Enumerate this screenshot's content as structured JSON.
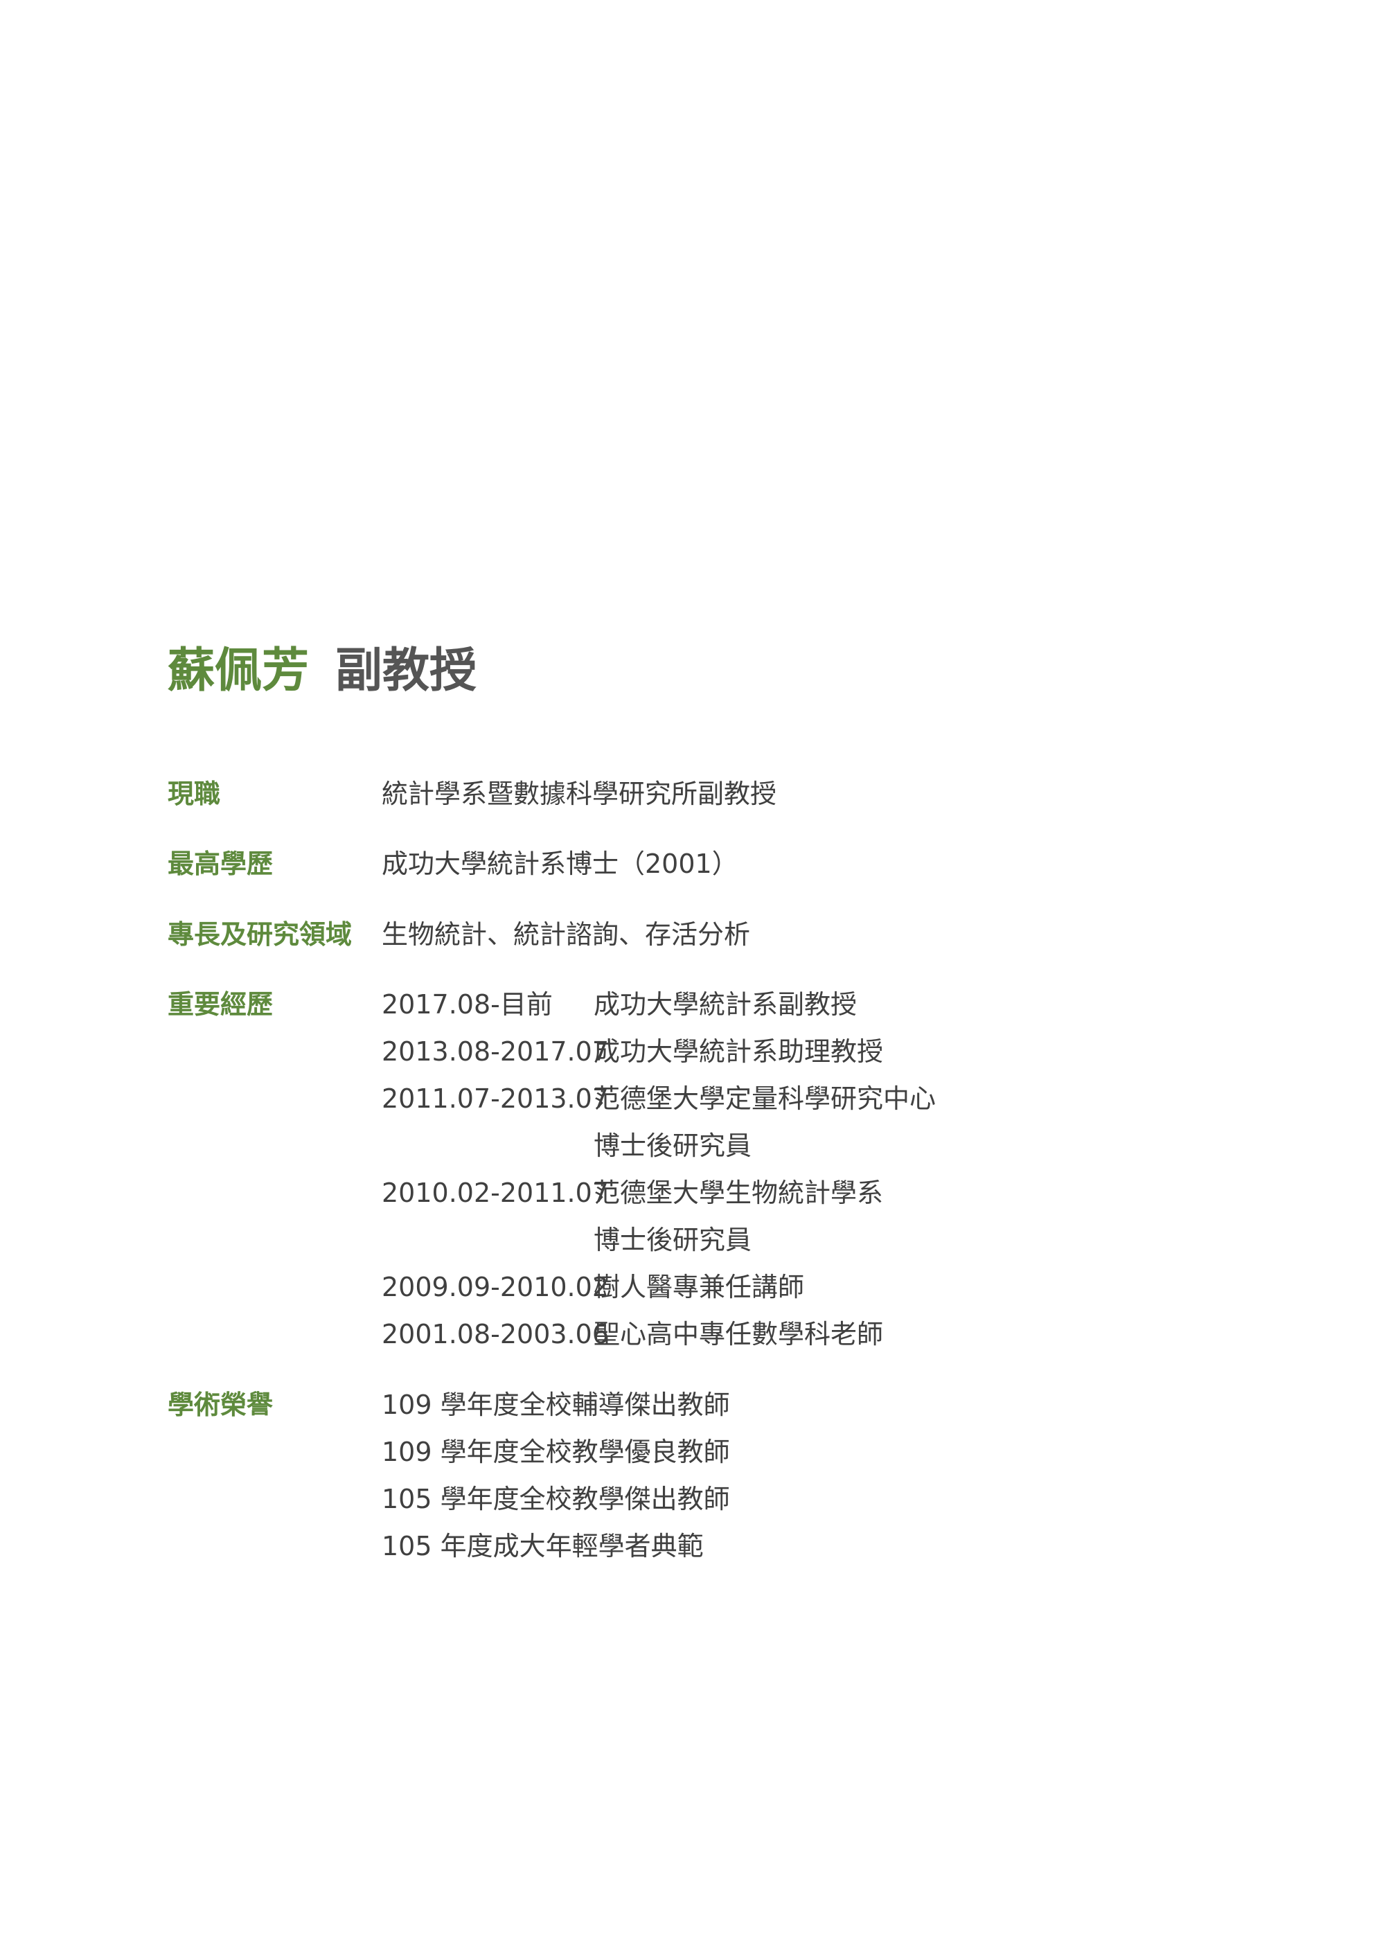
{
  "profile": {
    "name": "蘇佩芳",
    "rank": "副教授",
    "fields": {
      "current_position": {
        "label": "現職",
        "value": "統計學系暨數據科學研究所副教授"
      },
      "highest_degree": {
        "label": "最高學歷",
        "value": "成功大學統計系博士（2001）"
      },
      "expertise": {
        "label": "專長及研究領域",
        "value": "生物統計、統計諮詢、存活分析"
      }
    },
    "experience": {
      "label": "重要經歷",
      "items": [
        {
          "period": "2017.08-目前",
          "lines": [
            "成功大學統計系副教授"
          ]
        },
        {
          "period": "2013.08-2017.07",
          "lines": [
            "成功大學統計系助理教授"
          ]
        },
        {
          "period": "2011.07-2013.07",
          "lines": [
            "范德堡大學定量科學研究中心",
            "博士後研究員"
          ]
        },
        {
          "period": "2010.02-2011.07",
          "lines": [
            "范德堡大學生物統計學系",
            "博士後研究員"
          ]
        },
        {
          "period": "2009.09-2010.02",
          "lines": [
            "樹人醫專兼任講師"
          ]
        },
        {
          "period": "2001.08-2003.06",
          "lines": [
            "聖心高中專任數學科老師"
          ]
        }
      ]
    },
    "honors": {
      "label": "學術榮譽",
      "items": [
        "109 學年度全校輔導傑出教師",
        "109 學年度全校教學優良教師",
        "105 學年度全校教學傑出教師",
        "105 年度成大年輕學者典範"
      ]
    },
    "colors": {
      "accent": "#5e8a3d",
      "text": "#404040"
    }
  }
}
